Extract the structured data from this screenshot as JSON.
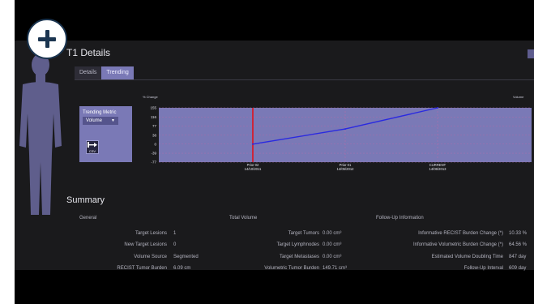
{
  "header": {
    "title": "T1 Details"
  },
  "tabs": [
    {
      "label": "Details",
      "active": false
    },
    {
      "label": "Trending",
      "active": true
    }
  ],
  "trending": {
    "metric_label": "Trending Metric",
    "metric_value": "Volume",
    "export_icon": "csv-export-icon",
    "export_label": "CSV"
  },
  "chart_data": {
    "type": "line",
    "ylabel": "% Change",
    "right_label": "Volume",
    "y_ticks": [
      155,
      116,
      77,
      38,
      0,
      -39,
      -77
    ],
    "ylim": [
      -77,
      155
    ],
    "categories": [
      {
        "label": "Prior 02",
        "date": "14/10/2011"
      },
      {
        "label": "Prior 01",
        "date": "14/05/2012"
      },
      {
        "label": "CURRENT",
        "date": "14/06/2013"
      }
    ],
    "series": [
      {
        "values": [
          0,
          64.56,
          155
        ]
      }
    ],
    "colors": {
      "line": "#2a2ae0",
      "baseline_marker": "#d61c2c",
      "plot_bg": "#7a79b6",
      "grid": "#b86aa8"
    }
  },
  "summary": {
    "title": "Summary",
    "general": {
      "header": "General",
      "rows": [
        {
          "label": "Target Lesions",
          "value": "1"
        },
        {
          "label": "New Target Lesions",
          "value": "0"
        },
        {
          "label": "Volume Source",
          "value": "Segmented"
        },
        {
          "label": "RECIST Tumor Burden",
          "value": "6.09 cm"
        }
      ]
    },
    "total_volume": {
      "header": "Total Volume",
      "rows": [
        {
          "label": "Target Tumors",
          "value": "0.00 cm³"
        },
        {
          "label": "Target Lymphnodes",
          "value": "0.00 cm³"
        },
        {
          "label": "Target Metastases",
          "value": "0.00 cm³"
        },
        {
          "label": "Volumetric Tumor Burden",
          "value": "149.71 cm³"
        }
      ]
    },
    "follow_up": {
      "header": "Follow-Up Information",
      "rows": [
        {
          "label": "Informative RECIST Burden Change (*)",
          "value": "10.33 %"
        },
        {
          "label": "Informative Volumetric Burden Change (*)",
          "value": "64.56 %"
        },
        {
          "label": "Estimated Volume Doubling Time",
          "value": "847 day"
        },
        {
          "label": "Follow-Up Interval",
          "value": "609 day"
        }
      ]
    }
  }
}
